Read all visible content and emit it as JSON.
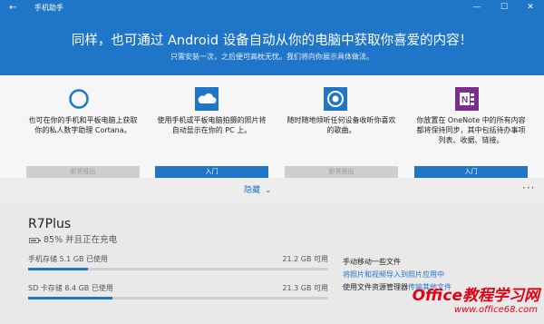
{
  "titlebar": {
    "back_glyph": "←",
    "title": "手机助手",
    "min_glyph": "—",
    "max_glyph": "☐",
    "close_glyph": "✕"
  },
  "hero": {
    "headline": "同样，也可通过 Android 设备自动从你的电脑中获取你喜爱的内容！",
    "subtitle": "只需安装一次，之后便可高枕无忧。我们将向你展示具体做法。"
  },
  "cards": [
    {
      "icon": "cortana-icon",
      "text": "也可在你的手机和平板电脑上获取你的私人数字助理 Cortana。",
      "button": "即将推出",
      "button_state": "disabled"
    },
    {
      "icon": "onedrive-icon",
      "text": "使用手机或平板电脑拍摄的照片将自动显示在你的 PC 上。",
      "button": "入门",
      "button_state": "primary"
    },
    {
      "icon": "groove-music-icon",
      "text": "随时随地倾听任何设备收听你喜欢的歌曲。",
      "button": "即将推出",
      "button_state": "disabled"
    },
    {
      "icon": "onenote-icon",
      "text": "你放置在 OneNote 中的所有内容都将保持同步，其中包括待办事项列表、收据、链接。",
      "button": "入门",
      "button_state": "primary"
    }
  ],
  "expander": {
    "label": "隐藏",
    "chevron": "⌄",
    "more": "···"
  },
  "device": {
    "name": "R7Plus",
    "battery_percent": 85,
    "battery_text": "85% 并且正在充电"
  },
  "storage": [
    {
      "label": "手机存储  5.1 GB 已使用",
      "available": "21.2 GB 可用",
      "used_fraction": 0.2
    },
    {
      "label": "SD 卡存储  8.4 GB 已使用",
      "available": "21.3 GB 可用",
      "used_fraction": 0.28
    }
  ],
  "manual": {
    "title": "手动移动一些文件",
    "link1": "将照片和视频导入到照片应用中",
    "line3_prefix": "使用文件资源管理器",
    "line3_link": "传输其他文件"
  },
  "watermark": {
    "line1": "Office教程学习网",
    "line2": "www.office68.com"
  },
  "colors": {
    "accent": "#1f76c9",
    "onenote": "#7a2f8f",
    "watermark": "#e60012"
  }
}
